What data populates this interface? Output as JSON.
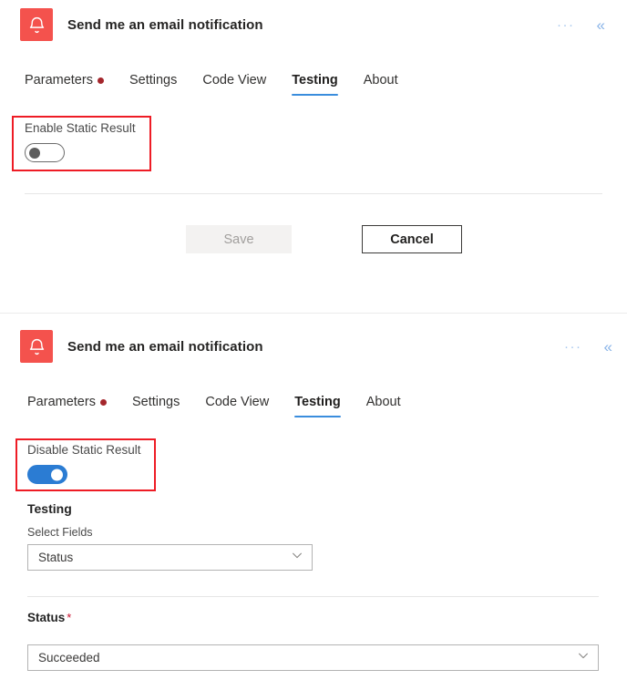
{
  "panels": [
    {
      "id": "top",
      "header": {
        "icon": "bell-icon",
        "title": "Send me an email notification",
        "more_label": "···",
        "collapse_label": "«"
      },
      "tabs": [
        {
          "label": "Parameters",
          "active": false,
          "dot": true
        },
        {
          "label": "Settings",
          "active": false,
          "dot": false
        },
        {
          "label": "Code View",
          "active": false,
          "dot": false
        },
        {
          "label": "Testing",
          "active": true,
          "dot": false
        },
        {
          "label": "About",
          "active": false,
          "dot": false
        }
      ],
      "static_result": {
        "label": "Enable Static Result",
        "state": "off"
      },
      "buttons": {
        "save_label": "Save",
        "save_disabled": true,
        "cancel_label": "Cancel"
      }
    },
    {
      "id": "bottom",
      "header": {
        "icon": "bell-icon",
        "title": "Send me an email notification",
        "more_label": "···",
        "collapse_label": "«"
      },
      "tabs": [
        {
          "label": "Parameters",
          "active": false,
          "dot": true
        },
        {
          "label": "Settings",
          "active": false,
          "dot": false
        },
        {
          "label": "Code View",
          "active": false,
          "dot": false
        },
        {
          "label": "Testing",
          "active": true,
          "dot": false
        },
        {
          "label": "About",
          "active": false,
          "dot": false
        }
      ],
      "static_result": {
        "label": "Disable Static Result",
        "state": "on"
      },
      "form": {
        "section_heading": "Testing",
        "select_fields_label": "Select Fields",
        "select_fields_value": "Status",
        "status_label": "Status",
        "status_required_mark": "*",
        "status_value": "Succeeded"
      }
    }
  ],
  "colors": {
    "icon_red": "#F4524D",
    "tab_accent": "#3a8ddd",
    "dot_red": "#a4262c",
    "toggle_on": "#2b7cd3",
    "annotation_red": "#ee1c25",
    "required_red": "#c8102e"
  }
}
